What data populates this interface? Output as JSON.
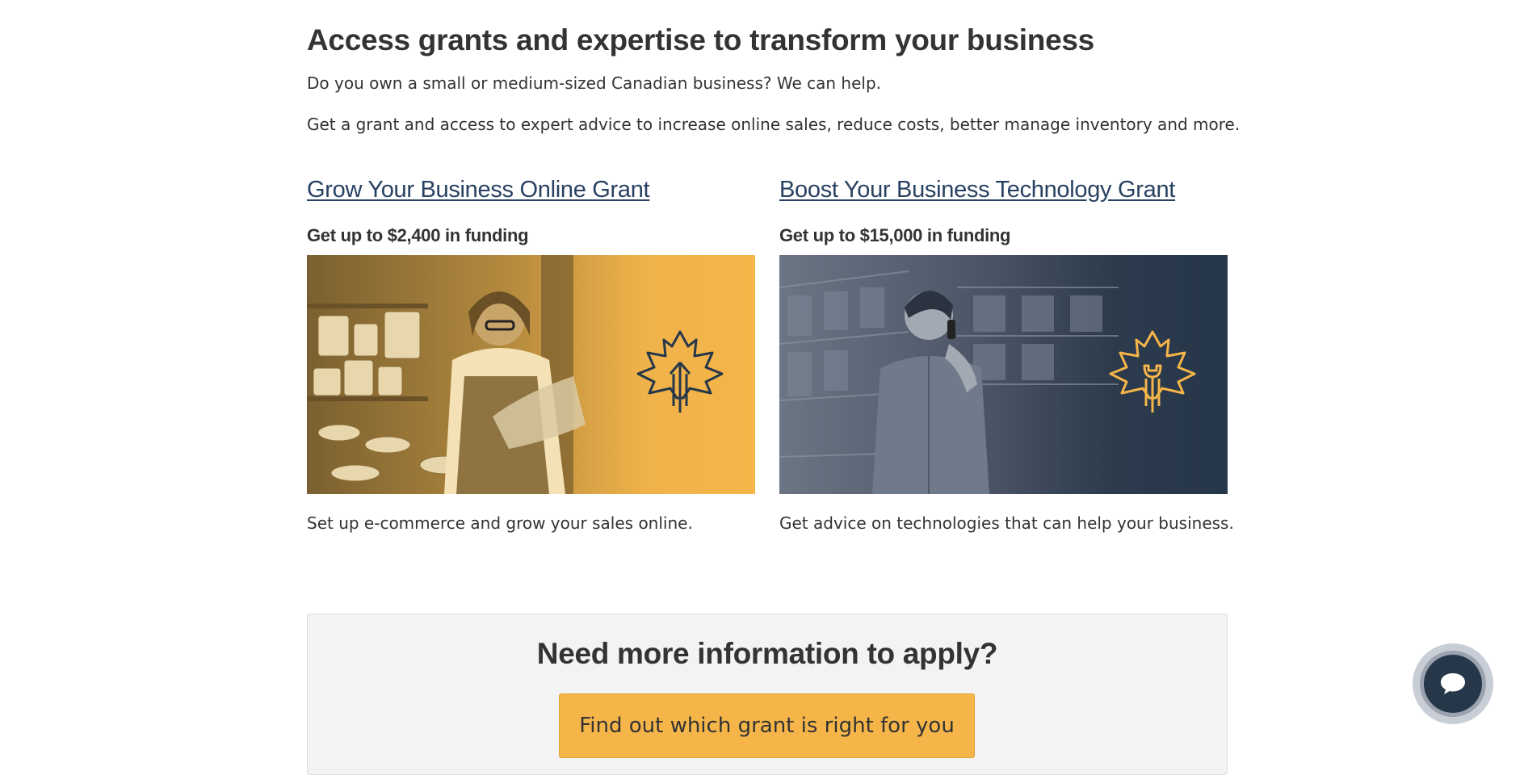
{
  "intro": {
    "title": "Access grants and expertise to transform your business",
    "paragraph1": "Do you own a small or medium-sized Canadian business? We can help.",
    "paragraph2": "Get a grant and access to expert advice to increase online sales, reduce costs, better manage inventory and more."
  },
  "grants": [
    {
      "title": "Grow Your Business Online Grant",
      "funding": "Get up to $2,400 in funding",
      "description": "Set up e-commerce and grow your sales online.",
      "icon": "maple-leaf-arrow-icon",
      "tint_color": "#f5b549"
    },
    {
      "title": "Boost Your Business Technology Grant",
      "funding": "Get up to $15,000 in funding",
      "description": "Get advice on technologies that can help your business.",
      "icon": "maple-leaf-wrench-icon",
      "tint_color": "#26374a"
    }
  ],
  "info_box": {
    "title": "Need more information to apply?",
    "button_label": "Find out which grant is right for you"
  },
  "chat": {
    "icon": "chat-bubble-icon"
  },
  "colors": {
    "link": "#284162",
    "accent": "#f5b549",
    "dark": "#26374a"
  }
}
